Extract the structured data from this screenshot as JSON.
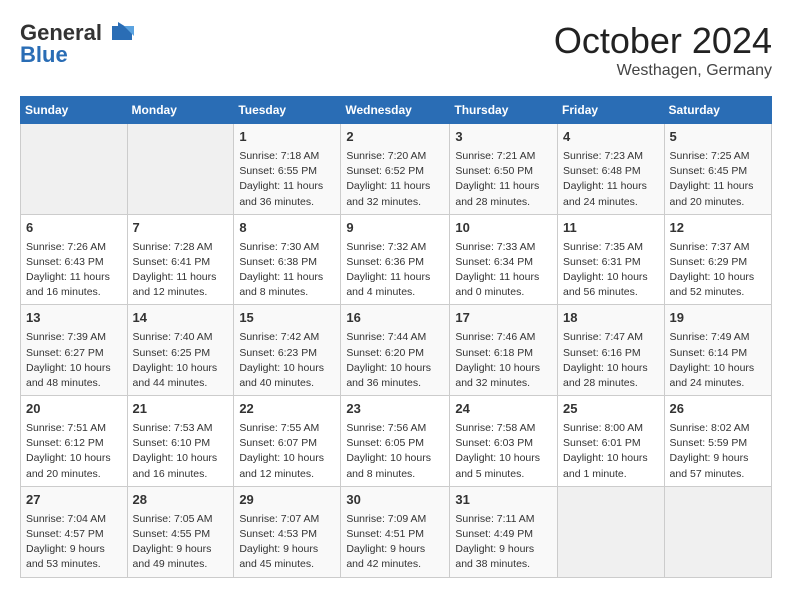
{
  "header": {
    "logo_general": "General",
    "logo_blue": "Blue",
    "month": "October 2024",
    "location": "Westhagen, Germany"
  },
  "weekdays": [
    "Sunday",
    "Monday",
    "Tuesday",
    "Wednesday",
    "Thursday",
    "Friday",
    "Saturday"
  ],
  "weeks": [
    [
      {
        "day": "",
        "info": ""
      },
      {
        "day": "",
        "info": ""
      },
      {
        "day": "1",
        "info": "Sunrise: 7:18 AM\nSunset: 6:55 PM\nDaylight: 11 hours\nand 36 minutes."
      },
      {
        "day": "2",
        "info": "Sunrise: 7:20 AM\nSunset: 6:52 PM\nDaylight: 11 hours\nand 32 minutes."
      },
      {
        "day": "3",
        "info": "Sunrise: 7:21 AM\nSunset: 6:50 PM\nDaylight: 11 hours\nand 28 minutes."
      },
      {
        "day": "4",
        "info": "Sunrise: 7:23 AM\nSunset: 6:48 PM\nDaylight: 11 hours\nand 24 minutes."
      },
      {
        "day": "5",
        "info": "Sunrise: 7:25 AM\nSunset: 6:45 PM\nDaylight: 11 hours\nand 20 minutes."
      }
    ],
    [
      {
        "day": "6",
        "info": "Sunrise: 7:26 AM\nSunset: 6:43 PM\nDaylight: 11 hours\nand 16 minutes."
      },
      {
        "day": "7",
        "info": "Sunrise: 7:28 AM\nSunset: 6:41 PM\nDaylight: 11 hours\nand 12 minutes."
      },
      {
        "day": "8",
        "info": "Sunrise: 7:30 AM\nSunset: 6:38 PM\nDaylight: 11 hours\nand 8 minutes."
      },
      {
        "day": "9",
        "info": "Sunrise: 7:32 AM\nSunset: 6:36 PM\nDaylight: 11 hours\nand 4 minutes."
      },
      {
        "day": "10",
        "info": "Sunrise: 7:33 AM\nSunset: 6:34 PM\nDaylight: 11 hours\nand 0 minutes."
      },
      {
        "day": "11",
        "info": "Sunrise: 7:35 AM\nSunset: 6:31 PM\nDaylight: 10 hours\nand 56 minutes."
      },
      {
        "day": "12",
        "info": "Sunrise: 7:37 AM\nSunset: 6:29 PM\nDaylight: 10 hours\nand 52 minutes."
      }
    ],
    [
      {
        "day": "13",
        "info": "Sunrise: 7:39 AM\nSunset: 6:27 PM\nDaylight: 10 hours\nand 48 minutes."
      },
      {
        "day": "14",
        "info": "Sunrise: 7:40 AM\nSunset: 6:25 PM\nDaylight: 10 hours\nand 44 minutes."
      },
      {
        "day": "15",
        "info": "Sunrise: 7:42 AM\nSunset: 6:23 PM\nDaylight: 10 hours\nand 40 minutes."
      },
      {
        "day": "16",
        "info": "Sunrise: 7:44 AM\nSunset: 6:20 PM\nDaylight: 10 hours\nand 36 minutes."
      },
      {
        "day": "17",
        "info": "Sunrise: 7:46 AM\nSunset: 6:18 PM\nDaylight: 10 hours\nand 32 minutes."
      },
      {
        "day": "18",
        "info": "Sunrise: 7:47 AM\nSunset: 6:16 PM\nDaylight: 10 hours\nand 28 minutes."
      },
      {
        "day": "19",
        "info": "Sunrise: 7:49 AM\nSunset: 6:14 PM\nDaylight: 10 hours\nand 24 minutes."
      }
    ],
    [
      {
        "day": "20",
        "info": "Sunrise: 7:51 AM\nSunset: 6:12 PM\nDaylight: 10 hours\nand 20 minutes."
      },
      {
        "day": "21",
        "info": "Sunrise: 7:53 AM\nSunset: 6:10 PM\nDaylight: 10 hours\nand 16 minutes."
      },
      {
        "day": "22",
        "info": "Sunrise: 7:55 AM\nSunset: 6:07 PM\nDaylight: 10 hours\nand 12 minutes."
      },
      {
        "day": "23",
        "info": "Sunrise: 7:56 AM\nSunset: 6:05 PM\nDaylight: 10 hours\nand 8 minutes."
      },
      {
        "day": "24",
        "info": "Sunrise: 7:58 AM\nSunset: 6:03 PM\nDaylight: 10 hours\nand 5 minutes."
      },
      {
        "day": "25",
        "info": "Sunrise: 8:00 AM\nSunset: 6:01 PM\nDaylight: 10 hours\nand 1 minute."
      },
      {
        "day": "26",
        "info": "Sunrise: 8:02 AM\nSunset: 5:59 PM\nDaylight: 9 hours\nand 57 minutes."
      }
    ],
    [
      {
        "day": "27",
        "info": "Sunrise: 7:04 AM\nSunset: 4:57 PM\nDaylight: 9 hours\nand 53 minutes."
      },
      {
        "day": "28",
        "info": "Sunrise: 7:05 AM\nSunset: 4:55 PM\nDaylight: 9 hours\nand 49 minutes."
      },
      {
        "day": "29",
        "info": "Sunrise: 7:07 AM\nSunset: 4:53 PM\nDaylight: 9 hours\nand 45 minutes."
      },
      {
        "day": "30",
        "info": "Sunrise: 7:09 AM\nSunset: 4:51 PM\nDaylight: 9 hours\nand 42 minutes."
      },
      {
        "day": "31",
        "info": "Sunrise: 7:11 AM\nSunset: 4:49 PM\nDaylight: 9 hours\nand 38 minutes."
      },
      {
        "day": "",
        "info": ""
      },
      {
        "day": "",
        "info": ""
      }
    ]
  ]
}
